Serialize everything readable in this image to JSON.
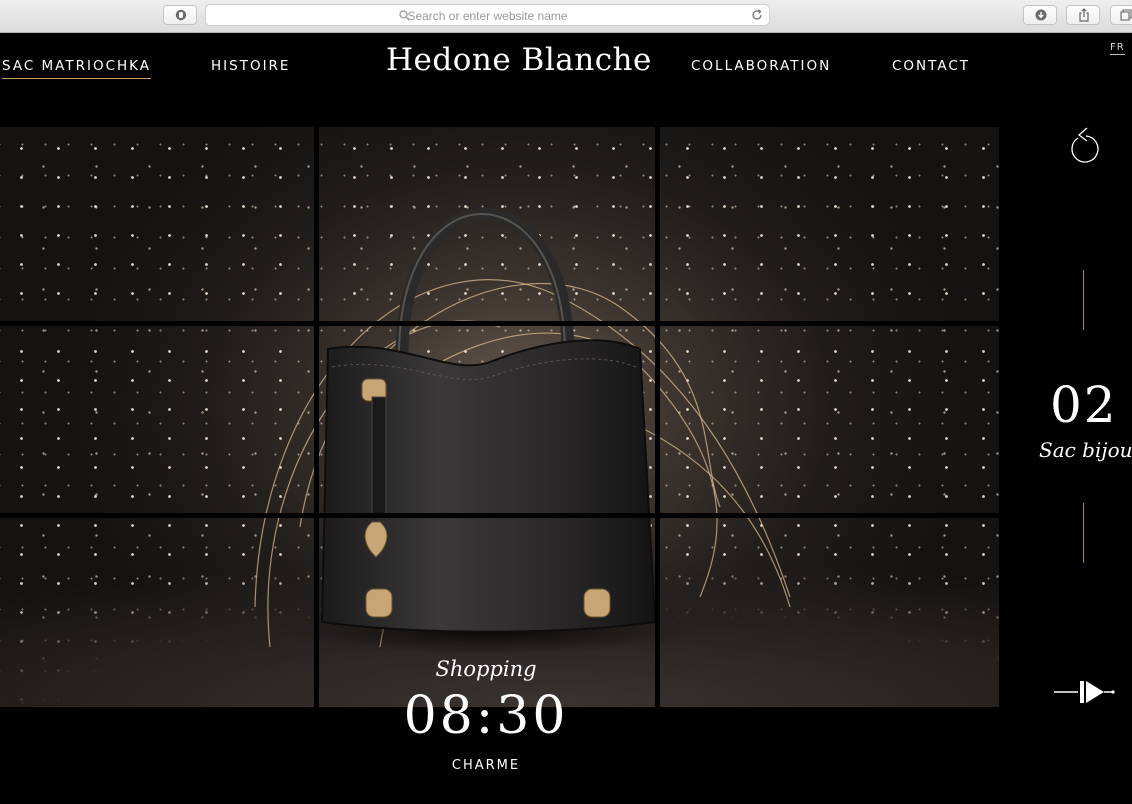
{
  "browser": {
    "url_placeholder": "Search or enter website name"
  },
  "nav": {
    "items": [
      {
        "label": "SAC MATRIOCHKA",
        "active": true
      },
      {
        "label": "HISTOIRE",
        "active": false
      },
      {
        "label": "COLLABORATION",
        "active": false
      },
      {
        "label": "CONTACT",
        "active": false
      }
    ],
    "logo": "Hedone Blanche",
    "language": "FR"
  },
  "slide": {
    "number": "02",
    "title": "Sac bijou",
    "time_category": "Shopping",
    "time": "08:30",
    "tag": "CHARME"
  },
  "colors": {
    "accent": "#c9a06a",
    "background": "#000000",
    "text": "#ffffff"
  },
  "icons": {
    "back": "replay-arrow-icon",
    "play": "play-icon"
  }
}
